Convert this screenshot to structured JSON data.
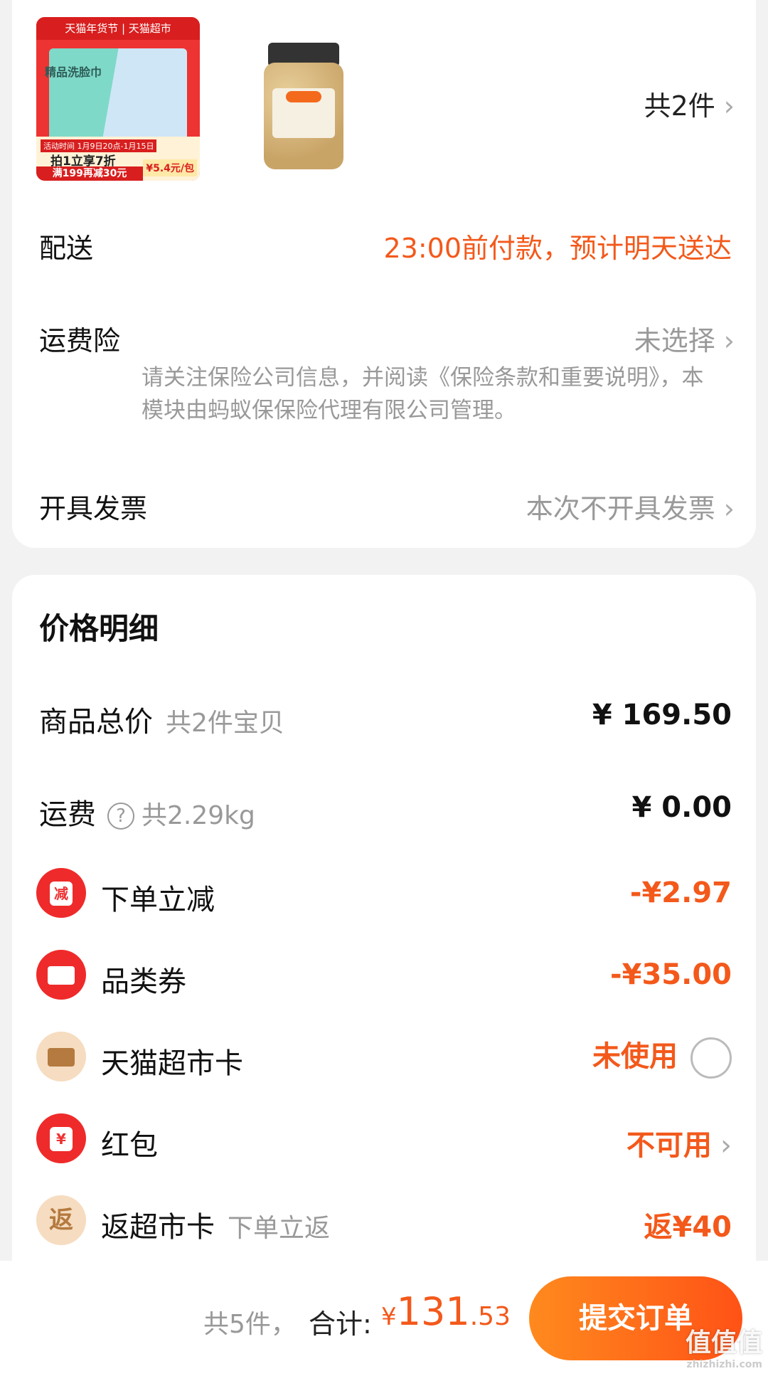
{
  "order": {
    "item1": {
      "top_banner": "天猫年货节 | 天猫超市",
      "pack_text": "精品洗脸巾",
      "promo_tag": "活动时间 1月9日20点-1月15日",
      "promo_main": "拍1立享7折",
      "promo_bottom": "满199再减30元",
      "promo_price": "¥5.4元/包"
    },
    "count_text": "共2件",
    "delivery_label": "配送",
    "delivery_value": "23:00前付款，预计明天送达",
    "insurance_label": "运费险",
    "insurance_value": "未选择",
    "insurance_note": "请关注保险公司信息，并阅读《保险条款和重要说明》，本模块由蚂蚁保保险代理有限公司管理。",
    "invoice_label": "开具发票",
    "invoice_value": "本次不开具发票"
  },
  "price_detail": {
    "title": "价格明细",
    "goods_total_label": "商品总价",
    "goods_total_sub": "共2件宝贝",
    "goods_total_value": "¥ 169.50",
    "shipping_label": "运费",
    "shipping_sub": "共2.29kg",
    "shipping_value": "¥ 0.00",
    "instant_discount_label": "下单立减",
    "instant_discount_icon": "减",
    "instant_discount_value": "-¥2.97",
    "category_coupon_label": "品类券",
    "category_coupon_value": "-¥35.00",
    "market_card_label": "天猫超市卡",
    "market_card_value": "未使用",
    "red_packet_label": "红包",
    "red_packet_icon": "¥",
    "red_packet_value": "不可用",
    "cashback_label": "返超市卡",
    "cashback_icon": "返",
    "cashback_sub": "下单立返",
    "cashback_value": "返¥40"
  },
  "bottom_bar": {
    "count": "共5件，",
    "total_label": "合计:",
    "total_yen": "¥",
    "total_int": "131",
    "total_dec": ".53",
    "submit": "提交订单",
    "watermark": "值值值",
    "watermark_sub": "zhizhizhi.com"
  },
  "colors": {
    "accent": "#f3591b",
    "red": "#ef2a2a"
  }
}
